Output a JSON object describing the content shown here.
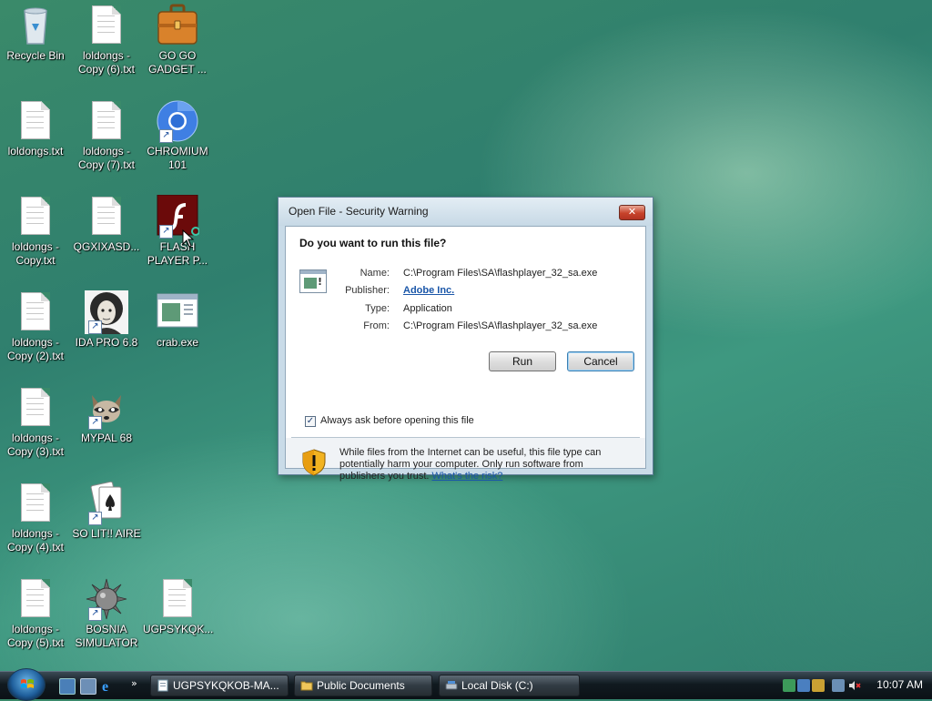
{
  "desktop": {
    "icons": [
      {
        "name": "recycle-bin",
        "label": "Recycle Bin",
        "icon": "recycle-bin-icon"
      },
      {
        "name": "loldongs-copy-6",
        "label": "loldongs - Copy (6).txt",
        "icon": "text-file-icon"
      },
      {
        "name": "go-go-gadget",
        "label": "GO GO GADGET ...",
        "icon": "briefcase-icon"
      },
      {
        "name": "loldongs",
        "label": "loldongs.txt",
        "icon": "text-file-icon"
      },
      {
        "name": "loldongs-copy-7",
        "label": "loldongs - Copy (7).txt",
        "icon": "text-file-icon"
      },
      {
        "name": "chromium-101",
        "label": "CHROMIUM 101",
        "icon": "chromium-icon"
      },
      {
        "name": "loldongs-copy",
        "label": "loldongs - Copy.txt",
        "icon": "text-file-icon"
      },
      {
        "name": "qgxixasd",
        "label": "QGXIXASD...",
        "icon": "text-file-icon"
      },
      {
        "name": "flash-player",
        "label": "FLASH PLAYER P...",
        "icon": "flash-player-icon"
      },
      {
        "name": "loldongs-copy-2",
        "label": "loldongs - Copy (2).txt",
        "icon": "text-file-icon"
      },
      {
        "name": "ida-pro",
        "label": "IDA PRO 6.8",
        "icon": "ida-pro-icon"
      },
      {
        "name": "crab-exe",
        "label": "crab.exe",
        "icon": "application-icon"
      },
      {
        "name": "loldongs-copy-3",
        "label": "loldongs - Copy (3).txt",
        "icon": "text-file-icon"
      },
      {
        "name": "mypal-68",
        "label": "MYPAL 68",
        "icon": "raccoon-icon"
      },
      {
        "name": "loldongs-copy-4",
        "label": "loldongs - Copy (4).txt",
        "icon": "text-file-icon"
      },
      {
        "name": "solitaire",
        "label": "SO LIT!! AIRE",
        "icon": "playing-cards-icon"
      },
      {
        "name": "loldongs-copy-5",
        "label": "loldongs - Copy (5).txt",
        "icon": "text-file-icon"
      },
      {
        "name": "bosnia-simulator",
        "label": "BOSNIA SIMULATOR",
        "icon": "spiked-mine-icon"
      },
      {
        "name": "ugpsykqk",
        "label": "UGPSYKQK...",
        "icon": "text-file-icon"
      }
    ]
  },
  "dialog": {
    "title": "Open File - Security Warning",
    "close_label": "✕",
    "question": "Do you want to run this file?",
    "fields": {
      "name_label": "Name:",
      "name_value": "C:\\Program Files\\SA\\flashplayer_32_sa.exe",
      "publisher_label": "Publisher:",
      "publisher_value": "Adobe Inc.",
      "type_label": "Type:",
      "type_value": "Application",
      "from_label": "From:",
      "from_value": "C:\\Program Files\\SA\\flashplayer_32_sa.exe"
    },
    "run_label": "Run",
    "cancel_label": "Cancel",
    "always_ask_label": "Always ask before opening this file",
    "always_ask_checked": true,
    "warning_text": "While files from the Internet can be useful, this file type can potentially harm your computer. Only run software from publishers you trust.",
    "risk_link": "What's the risk?"
  },
  "taskbar": {
    "tasks": [
      {
        "label": "UGPSYKQKOB-MA...",
        "icon": "notepad-icon"
      },
      {
        "label": "Public Documents",
        "icon": "folder-icon"
      },
      {
        "label": "Local Disk (C:)",
        "icon": "drive-icon"
      }
    ],
    "more_label": "»",
    "clock": "10:07 AM"
  },
  "colors": {
    "desktop": "#2f7f6e",
    "dialog_frame": "#c9dbe8",
    "link": "#1a56a8",
    "taskbar": "#111a20"
  }
}
